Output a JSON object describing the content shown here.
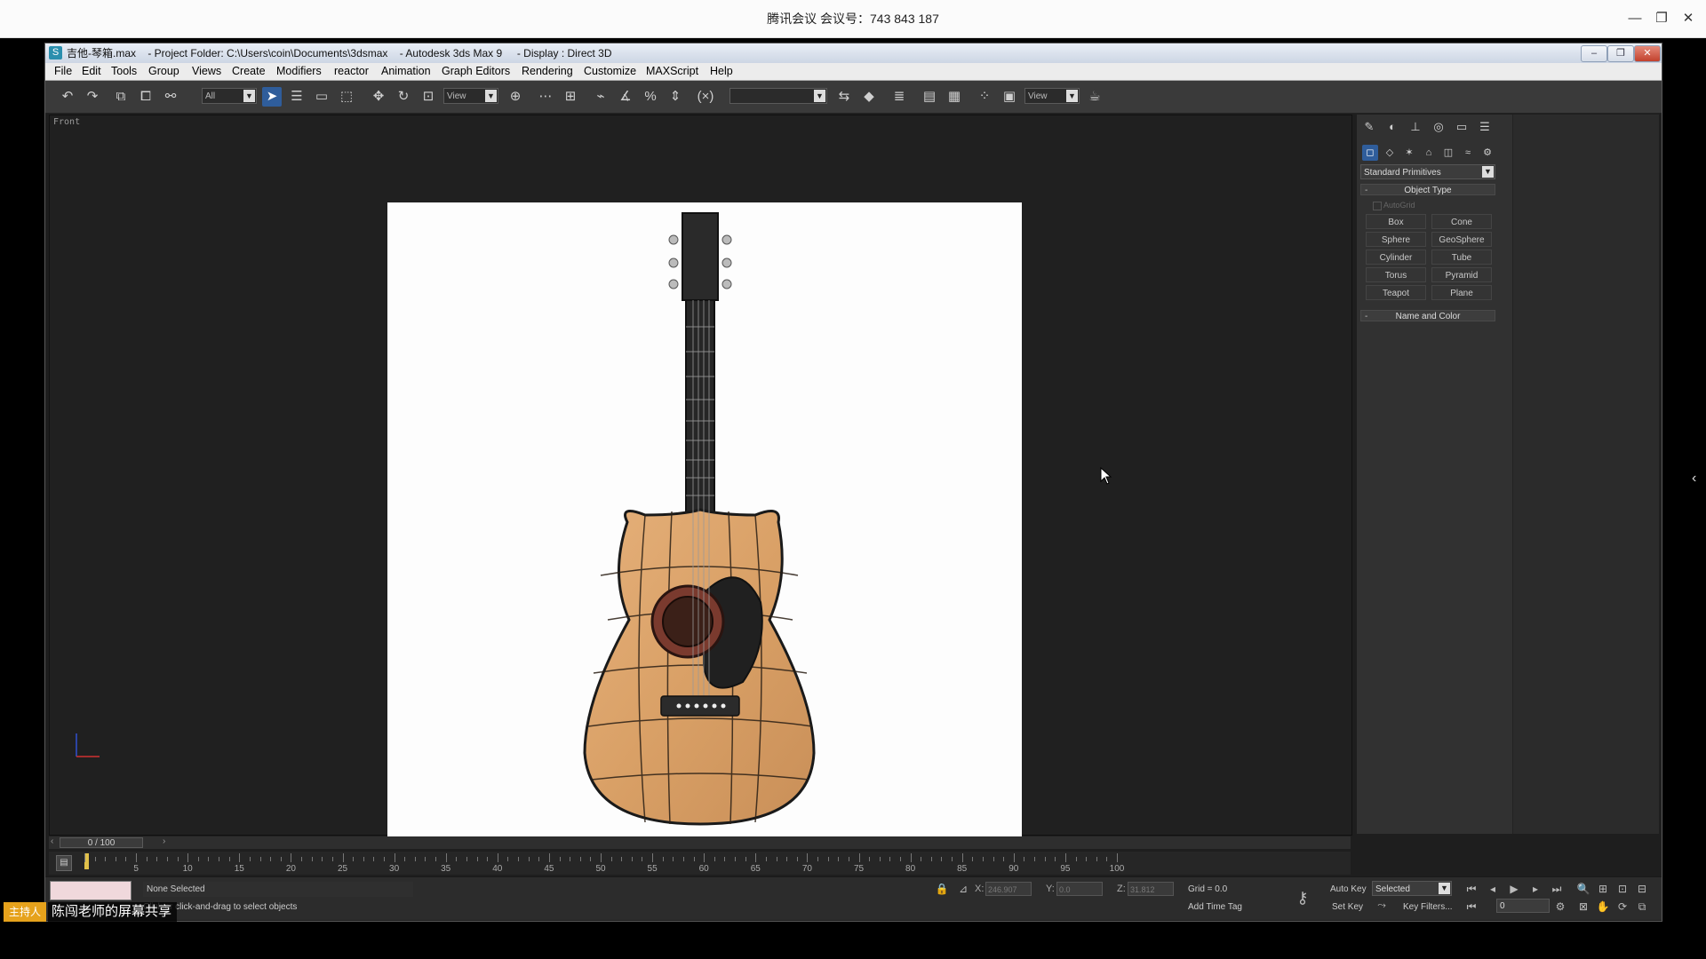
{
  "meeting": {
    "title": "腾讯会议 会议号：743 843 187",
    "host_badge": "主持人",
    "share_label": "陈闯老师的屏幕共享"
  },
  "window": {
    "title": "吉他-琴箱.max    - Project Folder: C:\\Users\\coin\\Documents\\3dsmax    - Autodesk 3ds Max 9     - Display : Direct 3D"
  },
  "menu": [
    "File",
    "Edit",
    "Tools",
    "Group",
    "Views",
    "Create",
    "Modifiers",
    "reactor",
    "Animation",
    "Graph Editors",
    "Rendering",
    "Customize",
    "MAXScript",
    "Help"
  ],
  "toolbar": {
    "selection_filter": "All",
    "ref_coord": "View",
    "named_selection": "",
    "render_view": "View"
  },
  "viewport": {
    "label": "Front"
  },
  "command_panel": {
    "category": "Standard Primitives",
    "object_type_title": "Object Type",
    "autogrid": "AutoGrid",
    "primitives": [
      "Box",
      "Cone",
      "Sphere",
      "GeoSphere",
      "Cylinder",
      "Tube",
      "Torus",
      "Pyramid",
      "Teapot",
      "Plane"
    ],
    "name_color_title": "Name and Color",
    "name_value": "",
    "color": "#b0173a"
  },
  "timeline": {
    "position": "0 / 100",
    "ticks": [
      "5",
      "10",
      "15",
      "20",
      "25",
      "30",
      "35",
      "40",
      "45",
      "50",
      "55",
      "60",
      "65",
      "70",
      "75",
      "80",
      "85",
      "90",
      "95",
      "100"
    ]
  },
  "status": {
    "selection": "None Selected",
    "prompt": "Click or click-and-drag to select objects",
    "x_label": "X:",
    "x_value": "246.907",
    "y_label": "Y:",
    "y_value": "0.0",
    "z_label": "Z:",
    "z_value": "31.812",
    "grid": "Grid = 0.0",
    "add_time_tag": "Add Time Tag",
    "auto_key": "Auto Key",
    "set_key": "Set Key",
    "key_mode": "Selected",
    "key_filters": "Key Filters...",
    "frame": "0"
  }
}
